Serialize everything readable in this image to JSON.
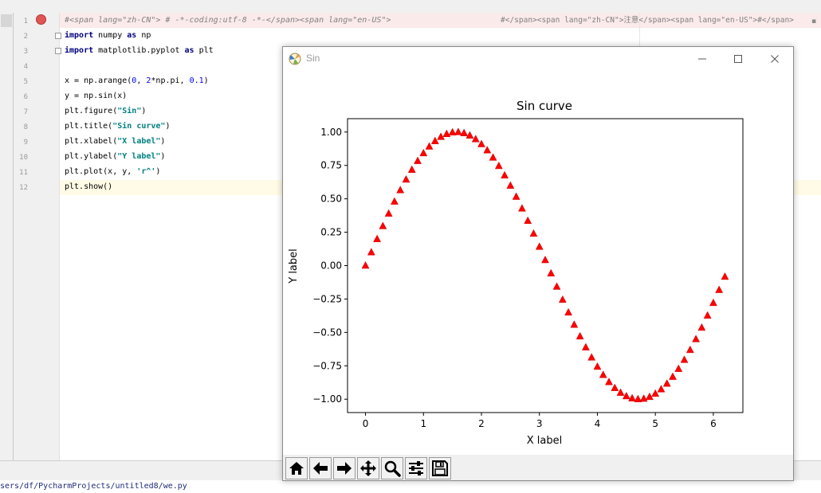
{
  "editor": {
    "lines": [
      {
        "n": "1",
        "tokens": [
          {
            "t": "#<span lang=\"zh-CN\"> # -*-coding:utf-8 -*-</span><span lang=\"en-US\">",
            "c": "cmt"
          }
        ]
      },
      {
        "n": "2",
        "tokens": [
          {
            "t": "import",
            "c": "kw"
          },
          {
            "t": " numpy ",
            "c": ""
          },
          {
            "t": "as",
            "c": "kw"
          },
          {
            "t": " np",
            "c": ""
          }
        ]
      },
      {
        "n": "3",
        "tokens": [
          {
            "t": "import",
            "c": "kw"
          },
          {
            "t": " matplotlib.pyplot ",
            "c": ""
          },
          {
            "t": "as",
            "c": "kw"
          },
          {
            "t": " plt",
            "c": ""
          }
        ]
      },
      {
        "n": "4",
        "tokens": []
      },
      {
        "n": "5",
        "tokens": [
          {
            "t": "x = np.arange(",
            "c": ""
          },
          {
            "t": "0",
            "c": "num"
          },
          {
            "t": ", ",
            "c": ""
          },
          {
            "t": "2",
            "c": "num"
          },
          {
            "t": "*np.pi, ",
            "c": ""
          },
          {
            "t": "0.1",
            "c": "num"
          },
          {
            "t": ")",
            "c": ""
          }
        ]
      },
      {
        "n": "6",
        "tokens": [
          {
            "t": "y = np.sin(x)",
            "c": ""
          }
        ]
      },
      {
        "n": "7",
        "tokens": [
          {
            "t": "plt.figure(",
            "c": ""
          },
          {
            "t": "\"Sin\"",
            "c": "str"
          },
          {
            "t": ")",
            "c": ""
          }
        ]
      },
      {
        "n": "8",
        "tokens": [
          {
            "t": "plt.title(",
            "c": ""
          },
          {
            "t": "\"Sin curve\"",
            "c": "str"
          },
          {
            "t": ")",
            "c": ""
          }
        ]
      },
      {
        "n": "9",
        "tokens": [
          {
            "t": "plt.xlabel(",
            "c": ""
          },
          {
            "t": "\"X label\"",
            "c": "str"
          },
          {
            "t": ")",
            "c": ""
          }
        ]
      },
      {
        "n": "10",
        "tokens": [
          {
            "t": "plt.ylabel(",
            "c": ""
          },
          {
            "t": "\"Y label\"",
            "c": "str"
          },
          {
            "t": ")",
            "c": ""
          }
        ]
      },
      {
        "n": "11",
        "tokens": [
          {
            "t": "plt.plot(x, y, ",
            "c": ""
          },
          {
            "t": "'r^'",
            "c": "str"
          },
          {
            "t": ")",
            "c": ""
          }
        ]
      },
      {
        "n": "12",
        "tokens": [
          {
            "t": "plt.show()",
            "c": ""
          }
        ]
      }
    ],
    "line1_tail": "#</span><span lang=\"zh-CN\">注意</span><span lang=\"en-US\">#</span>",
    "status_path": "sers/df/PycharmProjects/untitled8/we.py"
  },
  "window": {
    "title": "Sin",
    "icons": {
      "app": "matplotlib-icon",
      "min": "minimize-icon",
      "max": "maximize-icon",
      "close": "close-icon"
    }
  },
  "toolbar": {
    "buttons": [
      {
        "name": "home-button",
        "icon": "home-icon"
      },
      {
        "name": "back-button",
        "icon": "arrow-left-icon"
      },
      {
        "name": "forward-button",
        "icon": "arrow-right-icon"
      },
      {
        "name": "pan-button",
        "icon": "move-icon"
      },
      {
        "name": "zoom-button",
        "icon": "magnifier-icon"
      },
      {
        "name": "subplots-button",
        "icon": "sliders-icon"
      },
      {
        "name": "save-button",
        "icon": "floppy-disk-icon"
      }
    ]
  },
  "chart_data": {
    "type": "scatter",
    "title": "Sin curve",
    "xlabel": "X label",
    "ylabel": "Y label",
    "xlim": [
      -0.31,
      6.51
    ],
    "ylim": [
      -1.1,
      1.1
    ],
    "xticks": [
      0,
      1,
      2,
      3,
      4,
      5,
      6
    ],
    "xtick_labels": [
      "0",
      "1",
      "2",
      "3",
      "4",
      "5",
      "6"
    ],
    "yticks": [
      1.0,
      0.75,
      0.5,
      0.25,
      0.0,
      -0.25,
      -0.5,
      -0.75,
      -1.0
    ],
    "ytick_labels": [
      "1.00",
      "0.75",
      "0.50",
      "0.25",
      "0.00",
      "−0.25",
      "−0.50",
      "−0.75",
      "−1.00"
    ],
    "grid": false,
    "marker": "triangle-up",
    "color": "#ff0000",
    "series": [
      {
        "x": [
          0.0,
          0.1,
          0.2,
          0.3,
          0.4,
          0.5,
          0.6,
          0.7,
          0.8,
          0.9,
          1.0,
          1.1,
          1.2,
          1.3,
          1.4,
          1.5,
          1.6,
          1.7,
          1.8,
          1.9,
          2.0,
          2.1,
          2.2,
          2.3,
          2.4,
          2.5,
          2.6,
          2.7,
          2.8,
          2.9,
          3.0,
          3.1,
          3.2,
          3.3,
          3.4,
          3.5,
          3.6,
          3.7,
          3.8,
          3.9,
          4.0,
          4.1,
          4.2,
          4.3,
          4.4,
          4.5,
          4.6,
          4.7,
          4.8,
          4.9,
          5.0,
          5.1,
          5.2,
          5.3,
          5.4,
          5.5,
          5.6,
          5.7,
          5.8,
          5.9,
          6.0,
          6.1,
          6.2
        ],
        "y": [
          0.0,
          0.0998,
          0.1987,
          0.2955,
          0.3894,
          0.4794,
          0.5646,
          0.6442,
          0.7174,
          0.7833,
          0.8415,
          0.8912,
          0.932,
          0.9636,
          0.9854,
          0.9975,
          0.9996,
          0.9917,
          0.9738,
          0.9463,
          0.9093,
          0.8632,
          0.8085,
          0.7457,
          0.6755,
          0.5985,
          0.5155,
          0.4274,
          0.335,
          0.2392,
          0.1411,
          0.0416,
          -0.0584,
          -0.1577,
          -0.2555,
          -0.3508,
          -0.4425,
          -0.5298,
          -0.6119,
          -0.6878,
          -0.7568,
          -0.8183,
          -0.8716,
          -0.9162,
          -0.9516,
          -0.9775,
          -0.9937,
          -0.9999,
          -0.9962,
          -0.9825,
          -0.9589,
          -0.9258,
          -0.8835,
          -0.8323,
          -0.7728,
          -0.7055,
          -0.6313,
          -0.5507,
          -0.4646,
          -0.3739,
          -0.2794,
          -0.1822,
          -0.0831
        ]
      }
    ]
  }
}
